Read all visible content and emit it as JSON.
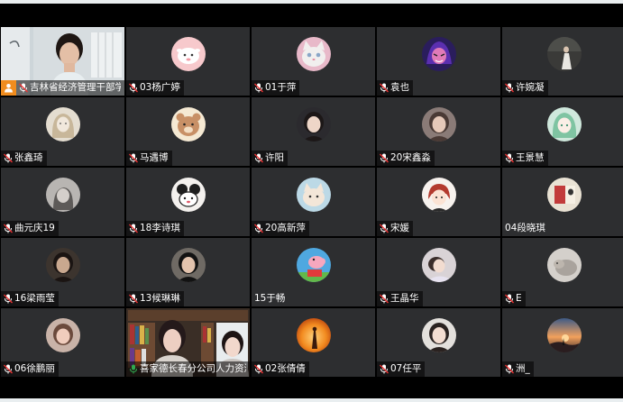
{
  "participants": [
    {
      "name": "吉林省经济管理干部学院",
      "avatar": "video-self",
      "mic": "muted",
      "host": true
    },
    {
      "name": "03杨广婷",
      "avatar": "pink-cartoon-sheep",
      "mic": "muted"
    },
    {
      "name": "01于萍",
      "avatar": "white-cat",
      "mic": "muted"
    },
    {
      "name": "袁也",
      "avatar": "purple-anime",
      "mic": "muted"
    },
    {
      "name": "许婉凝",
      "avatar": "dark-photo-figure",
      "mic": "muted"
    },
    {
      "name": "张鑫琦",
      "avatar": "sketch-girl",
      "mic": "muted"
    },
    {
      "name": "马遇博",
      "avatar": "cartoon-bear",
      "mic": "muted"
    },
    {
      "name": "许阳",
      "avatar": "girl-photo",
      "mic": "muted"
    },
    {
      "name": "20宋鑫淼",
      "avatar": "girl-portrait",
      "mic": "muted"
    },
    {
      "name": "王景慧",
      "avatar": "anime-green-hair",
      "mic": "muted"
    },
    {
      "name": "曲元庆19",
      "avatar": "grey-sketch",
      "mic": "muted"
    },
    {
      "name": "18李诗琪",
      "avatar": "black-white-cartoon",
      "mic": "muted"
    },
    {
      "name": "20高新萍",
      "avatar": "pastel-animal",
      "mic": "muted"
    },
    {
      "name": "宋媛",
      "avatar": "red-hair-cartoon",
      "mic": "muted"
    },
    {
      "name": "04段晓琪",
      "avatar": "book-photo",
      "mic": "none"
    },
    {
      "name": "16梁雨莹",
      "avatar": "dark-portrait",
      "mic": "muted"
    },
    {
      "name": "13候琳琳",
      "avatar": "boy-photo",
      "mic": "muted"
    },
    {
      "name": "15于畅",
      "avatar": "peppa-pig",
      "mic": "none"
    },
    {
      "name": "王晶华",
      "avatar": "lying-girl",
      "mic": "muted"
    },
    {
      "name": "E",
      "avatar": "grey-cat",
      "mic": "muted"
    },
    {
      "name": "06徐鹏丽",
      "avatar": "blurred-portrait",
      "mic": "muted"
    },
    {
      "name": "喜家德长春分公司人力资源部",
      "avatar": "video-two-people",
      "mic": "active"
    },
    {
      "name": "02张倩倩",
      "avatar": "sunset-silhouette",
      "mic": "muted"
    },
    {
      "name": "07任平",
      "avatar": "girl-hand-face",
      "mic": "muted"
    },
    {
      "name": "洲_",
      "avatar": "sunset-landscape",
      "mic": "muted"
    }
  ],
  "colors": {
    "tile_background": "#2d2e30",
    "host_badge": "#f08c1e",
    "mic_active": "#2fa84f",
    "mic_muted": "#ffffff",
    "speaking_border": "#2fa84f"
  }
}
